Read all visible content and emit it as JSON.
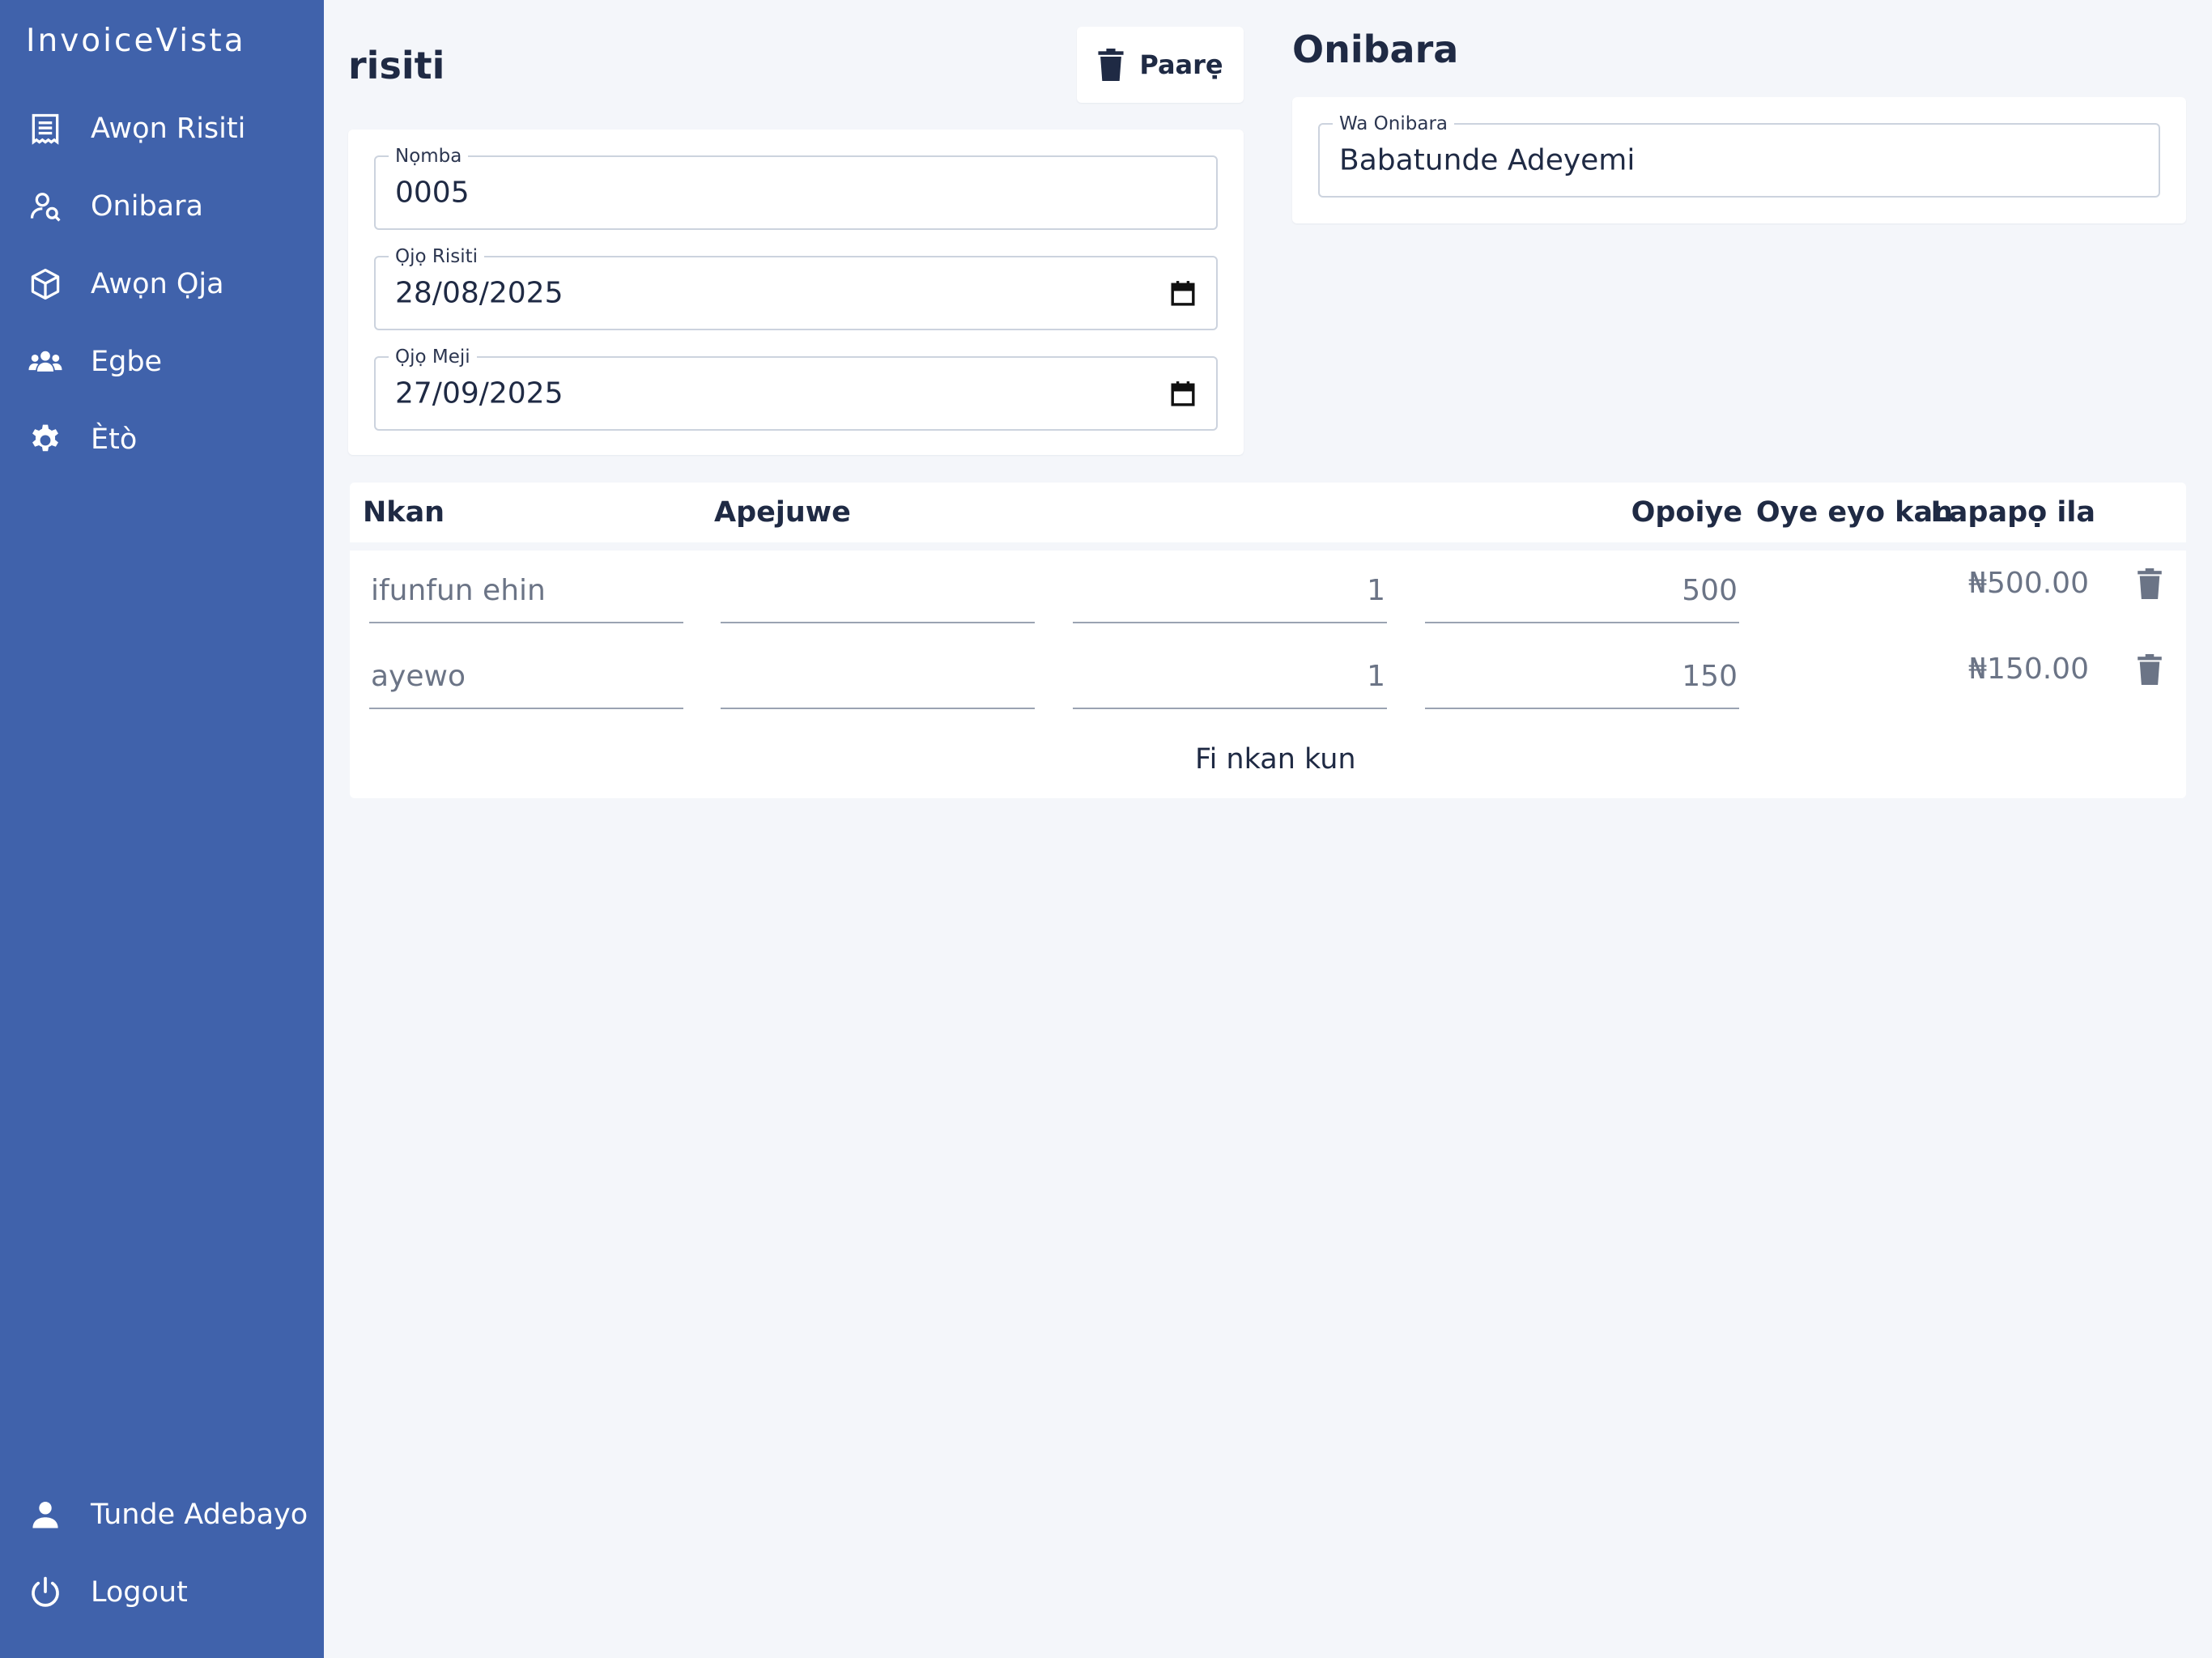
{
  "app": {
    "brand": "InvoiceVista"
  },
  "sidebar": {
    "items": [
      {
        "label": "Awọn Risiti",
        "icon": "receipt-icon"
      },
      {
        "label": "Onibara",
        "icon": "user-search-icon"
      },
      {
        "label": "Awọn Ọja",
        "icon": "box-icon"
      },
      {
        "label": "Egbe",
        "icon": "group-icon"
      },
      {
        "label": "Ètò",
        "icon": "gear-icon"
      }
    ],
    "user": {
      "label": "Tunde Adebayo",
      "icon": "person-icon"
    },
    "logout": {
      "label": "Logout",
      "icon": "power-icon"
    }
  },
  "invoice": {
    "title": "risiti",
    "delete_label": "Paarẹ",
    "number": {
      "label": "Nọmba",
      "value": "0005"
    },
    "invoice_date": {
      "label": "Ọjọ Risiti",
      "value": "28/08/2025"
    },
    "due_date": {
      "label": "Ọjọ Meji",
      "value": "27/09/2025"
    }
  },
  "customer": {
    "title": "Onibara",
    "find": {
      "label": "Wa Onibara",
      "value": "Babatunde Adeyemi"
    }
  },
  "items_table": {
    "headers": {
      "item": "Nkan",
      "description": "Apejuwe",
      "quantity": "Opoiye",
      "unit_price": "Oye eyo kan",
      "total": "Lapapọ ila"
    },
    "rows": [
      {
        "item": "ifunfun ehin",
        "description": "",
        "quantity": "1",
        "unit_price": "500",
        "total": "₦500.00"
      },
      {
        "item": "ayewo",
        "description": "",
        "quantity": "1",
        "unit_price": "150",
        "total": "₦150.00"
      }
    ],
    "add_item_label": "Fi nkan kun"
  },
  "colors": {
    "sidebar_bg": "#4062ab",
    "page_bg": "#f4f6fa",
    "text_dark": "#1f2a44",
    "text_muted": "#6b7486"
  }
}
